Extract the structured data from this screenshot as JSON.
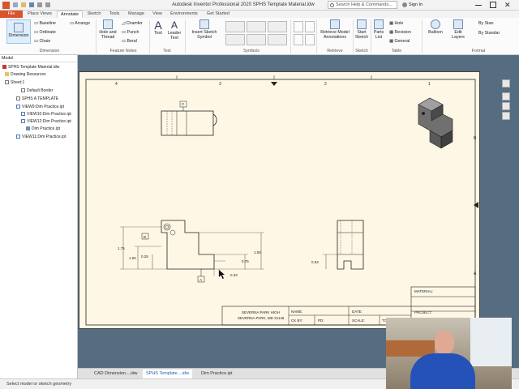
{
  "titlebar": {
    "app_title": "Autodesk Inventor Professional 2020    SPHS Template Material.idw",
    "search_placeholder": "Search Help & Commands...",
    "signin": "Sign In"
  },
  "tabs": [
    "File",
    "Place Views",
    "Annotate",
    "Sketch",
    "Tools",
    "Manage",
    "View",
    "Environments",
    "Get Started"
  ],
  "ribbon": {
    "dimension": "Dimension",
    "baseline": "Baseline",
    "ordinate": "Ordinate",
    "chain": "Chain",
    "arrange": "Arrange",
    "hole_thread": "Hole and Thread",
    "chamfer": "Chamfer",
    "punch": "Punch",
    "bend": "Bend",
    "text": "Text",
    "leader_text": "Leader Text",
    "insert_sketch_symbol": "Insert Sketch Symbol",
    "retrieve_model_annotations": "Retrieve Model Annotations",
    "start_sketch": "Start Sketch",
    "parts_list": "Parts List",
    "hole": "Hole",
    "revision": "Revision",
    "general": "General",
    "balloon": "Balloon",
    "edit_layers": "Edit Layers",
    "by_stan": "By Stan",
    "by_standar": "By Standar",
    "panel_dimension": "Dimension",
    "panel_feature_notes": "Feature Notes",
    "panel_text": "Text",
    "panel_symbols": "Symbols",
    "panel_retrieve": "Retrieve",
    "panel_sketch": "Sketch",
    "panel_table": "Table",
    "panel_format": "Format"
  },
  "browser": {
    "header": "Model",
    "items": [
      "SPHS Template Material.idw",
      "Drawing Resources",
      "Sheet:1",
      "Default Border",
      "SPHS A TEMPLATE",
      "VIEW9:Dim Practice.ipt",
      "VIEW10:Dim Practice.ipt",
      "VIEW12:Dim Practice.ipt",
      "Dim Practice.ipt",
      "VIEW11:Dim Practice.ipt"
    ]
  },
  "sheet": {
    "zones_top": [
      "4",
      "3",
      "2",
      "1"
    ],
    "zones_side": [
      "B",
      "A"
    ],
    "datum_c": "C",
    "datum_b": "B",
    "datum_a": "A",
    "dims": {
      "d175": "1.75",
      "d100": "1.00",
      "d025": "0.25",
      "d150": "1.50",
      "d075": "0.75",
      "d033": "0.33",
      "d063": "0.63"
    },
    "title_block": {
      "material": "MATERIAL:",
      "project": "PROJECT:",
      "school_line1": "SEVERNA PARK HIGH",
      "school_line2": "SEVERNA PARK, MD 21146",
      "name": "NAME:",
      "date": "DATE:",
      "ck_by": "CK BY:",
      "pd": "PD:",
      "scale": "SCALE:",
      "to": "TO"
    }
  },
  "doc_tabs": [
    "CAD Dimension....idw",
    "SPHS Template....idw",
    "Dim Practice.ipt"
  ],
  "status": "Select model or sketch geometry",
  "colors": {
    "file_tab": "#d9532b",
    "canvas": "#566c80",
    "sheet": "#fff7e6",
    "accent": "#1a5fb4"
  }
}
